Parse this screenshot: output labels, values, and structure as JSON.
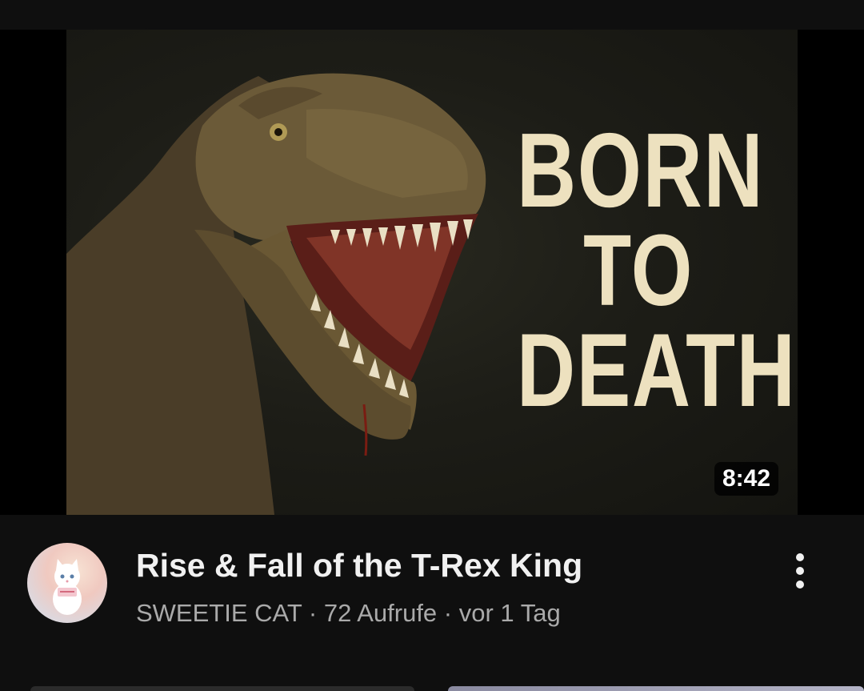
{
  "video": {
    "thumbnail_text": {
      "line1": "BORN",
      "line2": "TO",
      "line3": "DEATH"
    },
    "duration": "8:42",
    "title": "Rise & Fall of the T-Rex King",
    "channel": "SWEETIE CAT",
    "separator": " · ",
    "views": "72 Aufrufe",
    "age": "vor 1 Tag"
  },
  "icons": {
    "more": "more-vert-icon",
    "avatar": "channel-avatar-cat"
  },
  "colors": {
    "background": "#0f0f0f",
    "title_text": "#f1f1f1",
    "secondary_text": "#aaaaaa",
    "thumbnail_text": "#ede1bf"
  }
}
